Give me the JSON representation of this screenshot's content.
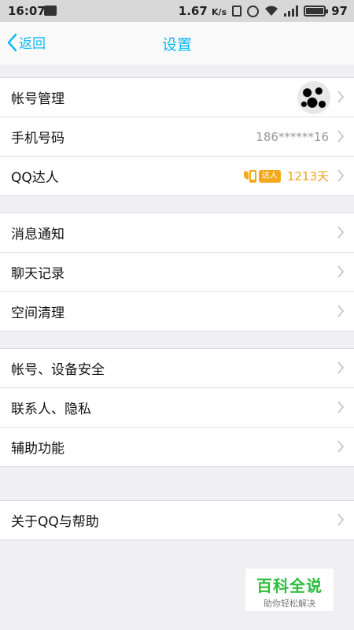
{
  "status_bar": {
    "time": "16:07",
    "speed": "1.67",
    "speed_unit": "K/s",
    "battery": "97",
    "icons": [
      "notification-icon",
      "vibrate-icon",
      "alarm-icon",
      "wifi-icon",
      "signal-icon",
      "battery-icon"
    ]
  },
  "nav": {
    "back_label": "返回",
    "title": "设置"
  },
  "colors": {
    "accent": "#12b7f5",
    "daren": "#f0a020",
    "background": "#efeff4"
  },
  "group1": {
    "account": "帐号管理",
    "phone": "手机号码",
    "phone_value": "186******16",
    "qq_daren": "QQ达人",
    "daren_badge": "达人",
    "daren_days": "1213天"
  },
  "group2": {
    "messages": "消息通知",
    "chat_history": "聊天记录",
    "space_clean": "空间清理"
  },
  "group3": {
    "security": "帐号、设备安全",
    "privacy": "联系人、隐私",
    "accessibility": "辅助功能"
  },
  "group4": {
    "about": "关于QQ与帮助"
  },
  "watermark": {
    "main": "百科全说",
    "sub": "助你轻松解决"
  }
}
